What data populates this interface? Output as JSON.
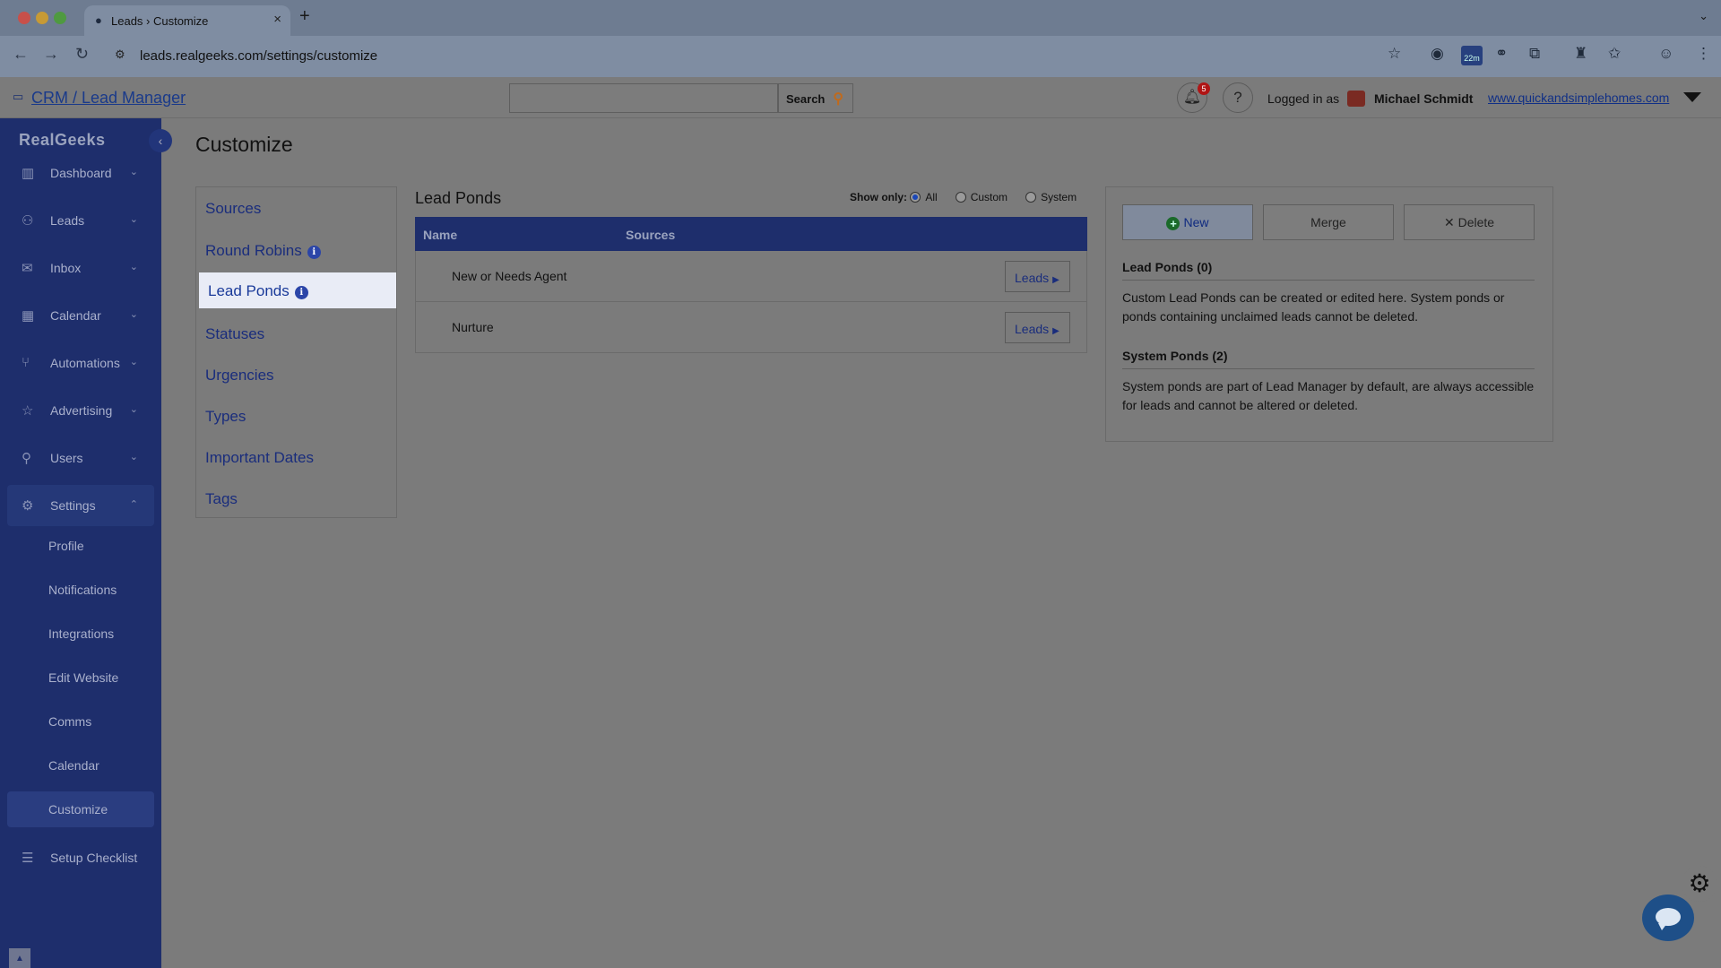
{
  "browser": {
    "tab_title": "Leads › Customize",
    "url": "leads.realgeeks.com/settings/customize",
    "ext_badge": "22m"
  },
  "header": {
    "crm_link": "CRM / Lead Manager",
    "search_value": "",
    "search_label": "Search",
    "notification_count": "5",
    "logged_in_label": "Logged in as",
    "user_name": "Michael Schmidt",
    "site_link": "www.quickandsimplehomes.com"
  },
  "sidebar": {
    "brand": "RealGeeks",
    "items": [
      {
        "label": "Dashboard",
        "icon": "bar-chart-icon"
      },
      {
        "label": "Leads",
        "icon": "people-icon"
      },
      {
        "label": "Inbox",
        "icon": "envelope-icon"
      },
      {
        "label": "Calendar",
        "icon": "calendar-icon"
      },
      {
        "label": "Automations",
        "icon": "branch-icon"
      },
      {
        "label": "Advertising",
        "icon": "star-icon"
      },
      {
        "label": "Users",
        "icon": "user-icon"
      },
      {
        "label": "Settings",
        "icon": "gear-icon"
      }
    ],
    "settings_sub": [
      "Profile",
      "Notifications",
      "Integrations",
      "Edit Website",
      "Comms",
      "Calendar",
      "Customize"
    ],
    "setup_checklist": "Setup Checklist"
  },
  "main": {
    "title": "Customize",
    "menu": [
      "Sources",
      "Round Robins",
      "Lead Ponds",
      "Statuses",
      "Urgencies",
      "Types",
      "Important Dates",
      "Tags"
    ],
    "ponds": {
      "title": "Lead Ponds",
      "show_only_label": "Show only:",
      "filters": [
        "All",
        "Custom",
        "System"
      ],
      "selected_filter": "All",
      "columns": [
        "Name",
        "Sources"
      ],
      "rows": [
        {
          "name": "New or Needs Agent",
          "action": "Leads"
        },
        {
          "name": "Nurture",
          "action": "Leads"
        }
      ]
    },
    "panel": {
      "new_label": "New",
      "merge_label": "Merge",
      "delete_label": "Delete",
      "lead_ponds_heading": "Lead Ponds (0)",
      "lead_ponds_text": "Custom Lead Ponds can be created or edited here. System ponds or ponds containing unclaimed leads cannot be deleted.",
      "system_ponds_heading": "System Ponds (2)",
      "system_ponds_text": "System ponds are part of Lead Manager by default, are always accessible for leads and cannot be altered or deleted."
    }
  },
  "colors": {
    "sidebar_bg": "#1e2e6c",
    "link": "#1a2d7c",
    "overlay_bg": "#7b7b7b"
  }
}
